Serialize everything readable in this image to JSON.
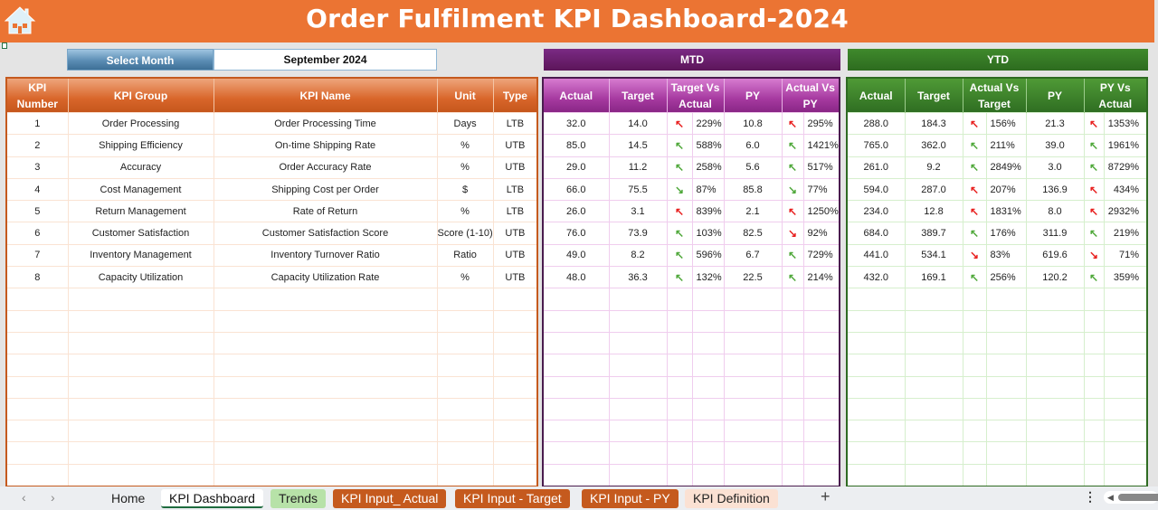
{
  "header": {
    "title": "Order Fulfilment KPI Dashboard-2024",
    "home_icon": "home-icon"
  },
  "selector": {
    "label": "Select Month",
    "value": "September 2024"
  },
  "sections": {
    "mtd": "MTD",
    "ytd": "YTD"
  },
  "colors": {
    "banner": "#eb7433",
    "mtd": "#6a1f6e",
    "ytd": "#2f6e22",
    "good_arrow": "#4fa83a",
    "bad_arrow": "#e8201f"
  },
  "left_headers": {
    "num": [
      "KPI",
      "Number"
    ],
    "group": "KPI Group",
    "name": "KPI Name",
    "unit": "Unit",
    "type": "Type"
  },
  "mtd_headers": {
    "actual": "Actual",
    "target": "Target",
    "tva": [
      "Target Vs",
      "Actual"
    ],
    "py": "PY",
    "avp": [
      "Actual Vs",
      "PY"
    ]
  },
  "ytd_headers": {
    "actual": "Actual",
    "target": "Target",
    "avt": [
      "Actual Vs",
      "Target"
    ],
    "py": "PY",
    "pva": [
      "PY Vs",
      "Actual"
    ]
  },
  "kpis": [
    {
      "num": "1",
      "group": "Order Processing",
      "name": "Order Processing Time",
      "unit": "Days",
      "type": "LTB",
      "mtd": {
        "actual": "32.0",
        "target": "14.0",
        "tva_dir": "up",
        "tva_good": false,
        "tva": "229%",
        "py": "10.8",
        "avp_dir": "up",
        "avp_good": false,
        "avp": "295%"
      },
      "ytd": {
        "actual": "288.0",
        "target": "184.3",
        "avt_dir": "up",
        "avt_good": false,
        "avt": "156%",
        "py": "21.3",
        "pva_dir": "up",
        "pva_good": false,
        "pva": "1353%"
      }
    },
    {
      "num": "2",
      "group": "Shipping Efficiency",
      "name": "On-time Shipping Rate",
      "unit": "%",
      "type": "UTB",
      "mtd": {
        "actual": "85.0",
        "target": "14.5",
        "tva_dir": "up",
        "tva_good": true,
        "tva": "588%",
        "py": "6.0",
        "avp_dir": "up",
        "avp_good": true,
        "avp": "1421%"
      },
      "ytd": {
        "actual": "765.0",
        "target": "362.0",
        "avt_dir": "up",
        "avt_good": true,
        "avt": "211%",
        "py": "39.0",
        "pva_dir": "up",
        "pva_good": true,
        "pva": "1961%"
      }
    },
    {
      "num": "3",
      "group": "Accuracy",
      "name": "Order Accuracy Rate",
      "unit": "%",
      "type": "UTB",
      "mtd": {
        "actual": "29.0",
        "target": "11.2",
        "tva_dir": "up",
        "tva_good": true,
        "tva": "258%",
        "py": "5.6",
        "avp_dir": "up",
        "avp_good": true,
        "avp": "517%"
      },
      "ytd": {
        "actual": "261.0",
        "target": "9.2",
        "avt_dir": "up",
        "avt_good": true,
        "avt": "2849%",
        "py": "3.0",
        "pva_dir": "up",
        "pva_good": true,
        "pva": "8729%"
      }
    },
    {
      "num": "4",
      "group": "Cost Management",
      "name": "Shipping Cost per Order",
      "unit": "$",
      "type": "LTB",
      "mtd": {
        "actual": "66.0",
        "target": "75.5",
        "tva_dir": "down",
        "tva_good": true,
        "tva": "87%",
        "py": "85.8",
        "avp_dir": "down",
        "avp_good": true,
        "avp": "77%"
      },
      "ytd": {
        "actual": "594.0",
        "target": "287.0",
        "avt_dir": "up",
        "avt_good": false,
        "avt": "207%",
        "py": "136.9",
        "pva_dir": "up",
        "pva_good": false,
        "pva": "434%"
      }
    },
    {
      "num": "5",
      "group": "Return Management",
      "name": "Rate of Return",
      "unit": "%",
      "type": "LTB",
      "mtd": {
        "actual": "26.0",
        "target": "3.1",
        "tva_dir": "up",
        "tva_good": false,
        "tva": "839%",
        "py": "2.1",
        "avp_dir": "up",
        "avp_good": false,
        "avp": "1250%"
      },
      "ytd": {
        "actual": "234.0",
        "target": "12.8",
        "avt_dir": "up",
        "avt_good": false,
        "avt": "1831%",
        "py": "8.0",
        "pva_dir": "up",
        "pva_good": false,
        "pva": "2932%"
      }
    },
    {
      "num": "6",
      "group": "Customer Satisfaction",
      "name": "Customer Satisfaction Score",
      "unit": "Score (1-10)",
      "type": "UTB",
      "mtd": {
        "actual": "76.0",
        "target": "73.9",
        "tva_dir": "up",
        "tva_good": true,
        "tva": "103%",
        "py": "82.5",
        "avp_dir": "down",
        "avp_good": false,
        "avp": "92%"
      },
      "ytd": {
        "actual": "684.0",
        "target": "389.7",
        "avt_dir": "up",
        "avt_good": true,
        "avt": "176%",
        "py": "311.9",
        "pva_dir": "up",
        "pva_good": true,
        "pva": "219%"
      }
    },
    {
      "num": "7",
      "group": "Inventory Management",
      "name": "Inventory Turnover Ratio",
      "unit": "Ratio",
      "type": "UTB",
      "mtd": {
        "actual": "49.0",
        "target": "8.2",
        "tva_dir": "up",
        "tva_good": true,
        "tva": "596%",
        "py": "6.7",
        "avp_dir": "up",
        "avp_good": true,
        "avp": "729%"
      },
      "ytd": {
        "actual": "441.0",
        "target": "534.1",
        "avt_dir": "down",
        "avt_good": false,
        "avt": "83%",
        "py": "619.6",
        "pva_dir": "down",
        "pva_good": false,
        "pva": "71%"
      }
    },
    {
      "num": "8",
      "group": "Capacity Utilization",
      "name": "Capacity Utilization Rate",
      "unit": "%",
      "type": "UTB",
      "mtd": {
        "actual": "48.0",
        "target": "36.3",
        "tva_dir": "up",
        "tva_good": true,
        "tva": "132%",
        "py": "22.5",
        "avp_dir": "up",
        "avp_good": true,
        "avp": "214%"
      },
      "ytd": {
        "actual": "432.0",
        "target": "169.1",
        "avt_dir": "up",
        "avt_good": true,
        "avt": "256%",
        "py": "120.2",
        "pva_dir": "up",
        "pva_good": true,
        "pva": "359%"
      }
    }
  ],
  "empty_rows": 9,
  "tabs": [
    {
      "label": "Home",
      "bg": "transparent",
      "fg": "#222"
    },
    {
      "label": "KPI Dashboard",
      "bg": "#ffffff",
      "fg": "#111",
      "active": true
    },
    {
      "label": "Trends",
      "bg": "#b7e2a8",
      "fg": "#222"
    },
    {
      "label": "KPI Input_ Actual",
      "bg": "#c55a1e",
      "fg": "#ffffff"
    },
    {
      "label": "KPI Input - Target",
      "bg": "#c55a1e",
      "fg": "#ffffff"
    },
    {
      "label": "KPI Input - PY",
      "bg": "#c55a1e",
      "fg": "#ffffff"
    },
    {
      "label": "KPI Definition",
      "bg": "#fbe1d3",
      "fg": "#222"
    }
  ],
  "tabbar": {
    "prev": "‹",
    "next": "›",
    "add": "+",
    "more": "⋮"
  }
}
